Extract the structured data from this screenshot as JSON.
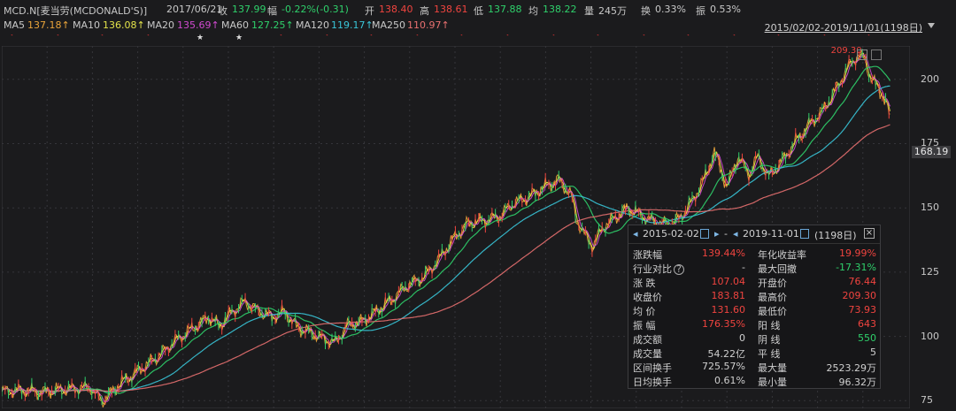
{
  "header": {
    "symbol": "MCD.N[麦当劳(MCDONALD'S)]",
    "date": "2017/06/21",
    "close_label": "收",
    "close_value": "137.99",
    "change_label": "幅",
    "change_value": "-0.22%(-0.31)",
    "open_label": "开",
    "open_value": "138.40",
    "high_label": "高",
    "high_value": "138.61",
    "low_label": "低",
    "low_value": "137.88",
    "avg_label": "均",
    "avg_value": "138.22",
    "volume_label": "量",
    "volume_value": "245万",
    "turnover_label": "换",
    "turnover_value": "0.33%",
    "amplitude_label": "振",
    "amplitude_value": "0.53%"
  },
  "ma_legend": [
    {
      "label": "MA5",
      "value": "137.18↑",
      "color": "#e8a33a"
    },
    {
      "label": "MA10",
      "value": "136.08↑",
      "color": "#e2e24a"
    },
    {
      "label": "MA20",
      "value": "135.69↑",
      "color": "#d04ad0"
    },
    {
      "label": "MA60",
      "value": "127.25↑",
      "color": "#2fd06b"
    },
    {
      "label": "MA120",
      "value": "119.17↑",
      "color": "#39c5d8"
    },
    {
      "label": "MA250",
      "value": "110.97↑",
      "color": "#e87070"
    }
  ],
  "date_range": "2015/02/02-2019/11/01(1198日)",
  "price_tag": "168.19",
  "stats_panel": {
    "start_date": "2015-02-02",
    "dash": "-",
    "end_date": "2019-11-01",
    "days": "(1198日)",
    "rows": [
      {
        "l1": "涨跌幅",
        "v1": "139.44%",
        "c1": "red",
        "l2": "年化收益率",
        "v2": "19.99%",
        "c2": "red"
      },
      {
        "l1": "行业对比",
        "v1": "-",
        "c1": "gray",
        "l2": "最大回撤",
        "v2": "-17.31%",
        "c2": "green",
        "help": true
      },
      {
        "l1": "涨 跌",
        "v1": "107.04",
        "c1": "red",
        "l2": "开盘价",
        "v2": "76.44",
        "c2": "red"
      },
      {
        "l1": "收盘价",
        "v1": "183.81",
        "c1": "red",
        "l2": "最高价",
        "v2": "209.30",
        "c2": "red"
      },
      {
        "l1": "均 价",
        "v1": "131.60",
        "c1": "red",
        "l2": "最低价",
        "v2": "73.93",
        "c2": "red"
      },
      {
        "l1": "振 幅",
        "v1": "176.35%",
        "c1": "red",
        "l2": "阳 线",
        "v2": "643",
        "c2": "red"
      },
      {
        "l1": "成交额",
        "v1": "0",
        "c1": "gray",
        "l2": "阴 线",
        "v2": "550",
        "c2": "green"
      },
      {
        "l1": "成交量",
        "v1": "54.22亿",
        "c1": "gray",
        "l2": "平 线",
        "v2": "5",
        "c2": "gray"
      },
      {
        "l1": "区间换手",
        "v1": "725.57%",
        "c1": "gray",
        "l2": "最大量",
        "v2": "2523.29万",
        "c2": "gray"
      },
      {
        "l1": "日均换手",
        "v1": "0.61%",
        "c1": "gray",
        "l2": "最小量",
        "v2": "96.32万",
        "c2": "gray"
      }
    ]
  },
  "chart_data": {
    "type": "line",
    "title": "",
    "ylim": [
      72,
      213
    ],
    "yticks": [
      75,
      100,
      125,
      150,
      175,
      200
    ],
    "high_annotation": "209.30",
    "low_annotation": "73.93",
    "x_range": [
      "2015-02-02",
      "2019-11-01"
    ],
    "grid": true,
    "price_keypoints": [
      [
        0.0,
        78.5
      ],
      [
        0.02,
        79.0
      ],
      [
        0.045,
        78.3
      ],
      [
        0.07,
        79.5
      ],
      [
        0.098,
        80.0
      ],
      [
        0.11,
        74.5
      ],
      [
        0.13,
        81.5
      ],
      [
        0.148,
        86.0
      ],
      [
        0.16,
        89.0
      ],
      [
        0.172,
        92.0
      ],
      [
        0.19,
        98.0
      ],
      [
        0.21,
        103.0
      ],
      [
        0.228,
        107.5
      ],
      [
        0.24,
        104.0
      ],
      [
        0.252,
        109.0
      ],
      [
        0.268,
        113.5
      ],
      [
        0.282,
        110.0
      ],
      [
        0.298,
        107.5
      ],
      [
        0.312,
        109.5
      ],
      [
        0.326,
        103.5
      ],
      [
        0.34,
        101.5
      ],
      [
        0.355,
        99.0
      ],
      [
        0.368,
        97.5
      ],
      [
        0.38,
        104.0
      ],
      [
        0.398,
        106.0
      ],
      [
        0.414,
        110.0
      ],
      [
        0.432,
        115.0
      ],
      [
        0.448,
        120.0
      ],
      [
        0.465,
        123.0
      ],
      [
        0.482,
        130.0
      ],
      [
        0.498,
        138.0
      ],
      [
        0.514,
        144.0
      ],
      [
        0.53,
        145.0
      ],
      [
        0.548,
        146.5
      ],
      [
        0.565,
        152.0
      ],
      [
        0.58,
        154.0
      ],
      [
        0.598,
        158.0
      ],
      [
        0.614,
        161.0
      ],
      [
        0.628,
        155.0
      ],
      [
        0.634,
        145.5
      ],
      [
        0.642,
        140.0
      ],
      [
        0.652,
        135.0
      ],
      [
        0.662,
        142.0
      ],
      [
        0.676,
        146.0
      ],
      [
        0.69,
        150.0
      ],
      [
        0.705,
        147.0
      ],
      [
        0.72,
        144.5
      ],
      [
        0.735,
        143.5
      ],
      [
        0.748,
        146.0
      ],
      [
        0.762,
        153.0
      ],
      [
        0.776,
        162.0
      ],
      [
        0.786,
        172.0
      ],
      [
        0.792,
        166.0
      ],
      [
        0.8,
        158.0
      ],
      [
        0.812,
        170.0
      ],
      [
        0.824,
        163.0
      ],
      [
        0.834,
        170.0
      ],
      [
        0.846,
        162.0
      ],
      [
        0.86,
        168.0
      ],
      [
        0.876,
        176.0
      ],
      [
        0.892,
        183.0
      ],
      [
        0.906,
        188.0
      ],
      [
        0.92,
        196.0
      ],
      [
        0.934,
        205.0
      ],
      [
        0.944,
        209.3
      ],
      [
        0.952,
        208.0
      ],
      [
        0.958,
        201.0
      ],
      [
        0.966,
        197.0
      ],
      [
        0.972,
        194.0
      ],
      [
        0.978,
        188.0
      ],
      [
        0.98,
        183.8
      ]
    ],
    "series": [
      {
        "name": "MA5",
        "color": "#e8a33a"
      },
      {
        "name": "MA10",
        "color": "#e2e24a"
      },
      {
        "name": "MA20",
        "color": "#d04ad0"
      },
      {
        "name": "MA60",
        "color": "#2fd06b"
      },
      {
        "name": "MA120",
        "color": "#39c5d8"
      },
      {
        "name": "MA250",
        "color": "#e87070"
      }
    ]
  }
}
